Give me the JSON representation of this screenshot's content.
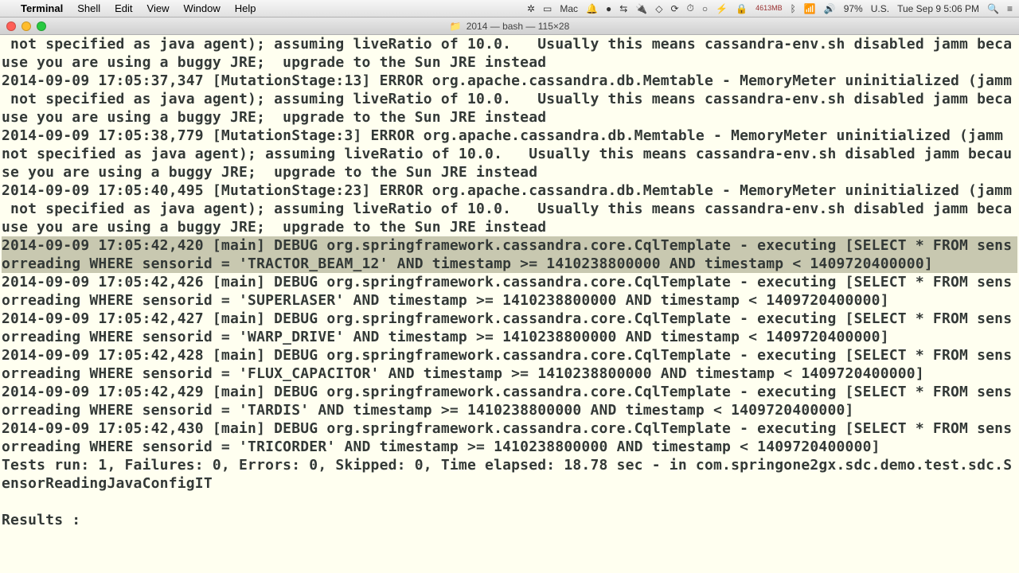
{
  "menubar": {
    "app": "Terminal",
    "items": [
      "Shell",
      "Edit",
      "View",
      "Window",
      "Help"
    ],
    "right": {
      "mac_label": "Mac",
      "mem": "4613MB",
      "battery": "97%",
      "flag": "U.S.",
      "datetime": "Tue Sep 9  5:06 PM"
    }
  },
  "window": {
    "title": "2014 — bash — 115×28"
  },
  "lines": [
    " not specified as java agent); assuming liveRatio of 10.0.   Usually this means cassandra-env.sh disabled jamm beca",
    "use you are using a buggy JRE;  upgrade to the Sun JRE instead",
    "2014-09-09 17:05:37,347 [MutationStage:13] ERROR org.apache.cassandra.db.Memtable - MemoryMeter uninitialized (jamm",
    " not specified as java agent); assuming liveRatio of 10.0.   Usually this means cassandra-env.sh disabled jamm beca",
    "use you are using a buggy JRE;  upgrade to the Sun JRE instead",
    "2014-09-09 17:05:38,779 [MutationStage:3] ERROR org.apache.cassandra.db.Memtable - MemoryMeter uninitialized (jamm ",
    "not specified as java agent); assuming liveRatio of 10.0.   Usually this means cassandra-env.sh disabled jamm becau",
    "se you are using a buggy JRE;  upgrade to the Sun JRE instead",
    "2014-09-09 17:05:40,495 [MutationStage:23] ERROR org.apache.cassandra.db.Memtable - MemoryMeter uninitialized (jamm",
    " not specified as java agent); assuming liveRatio of 10.0.   Usually this means cassandra-env.sh disabled jamm beca",
    "use you are using a buggy JRE;  upgrade to the Sun JRE instead",
    "2014-09-09 17:05:42,420 [main] DEBUG org.springframework.cassandra.core.CqlTemplate - executing [SELECT * FROM sens",
    "orreading WHERE sensorid = 'TRACTOR_BEAM_12' AND timestamp >= 1410238800000 AND timestamp < 1409720400000]",
    "2014-09-09 17:05:42,426 [main] DEBUG org.springframework.cassandra.core.CqlTemplate - executing [SELECT * FROM sens",
    "orreading WHERE sensorid = 'SUPERLASER' AND timestamp >= 1410238800000 AND timestamp < 1409720400000]",
    "2014-09-09 17:05:42,427 [main] DEBUG org.springframework.cassandra.core.CqlTemplate - executing [SELECT * FROM sens",
    "orreading WHERE sensorid = 'WARP_DRIVE' AND timestamp >= 1410238800000 AND timestamp < 1409720400000]",
    "2014-09-09 17:05:42,428 [main] DEBUG org.springframework.cassandra.core.CqlTemplate - executing [SELECT * FROM sens",
    "orreading WHERE sensorid = 'FLUX_CAPACITOR' AND timestamp >= 1410238800000 AND timestamp < 1409720400000]",
    "2014-09-09 17:05:42,429 [main] DEBUG org.springframework.cassandra.core.CqlTemplate - executing [SELECT * FROM sens",
    "orreading WHERE sensorid = 'TARDIS' AND timestamp >= 1410238800000 AND timestamp < 1409720400000]",
    "2014-09-09 17:05:42,430 [main] DEBUG org.springframework.cassandra.core.CqlTemplate - executing [SELECT * FROM sens",
    "orreading WHERE sensorid = 'TRICORDER' AND timestamp >= 1410238800000 AND timestamp < 1409720400000]",
    "Tests run: 1, Failures: 0, Errors: 0, Skipped: 0, Time elapsed: 18.78 sec - in com.springone2gx.sdc.demo.test.sdc.S",
    "ensorReadingJavaConfigIT",
    "",
    "Results :"
  ],
  "highlight_indices": [
    11,
    12
  ]
}
